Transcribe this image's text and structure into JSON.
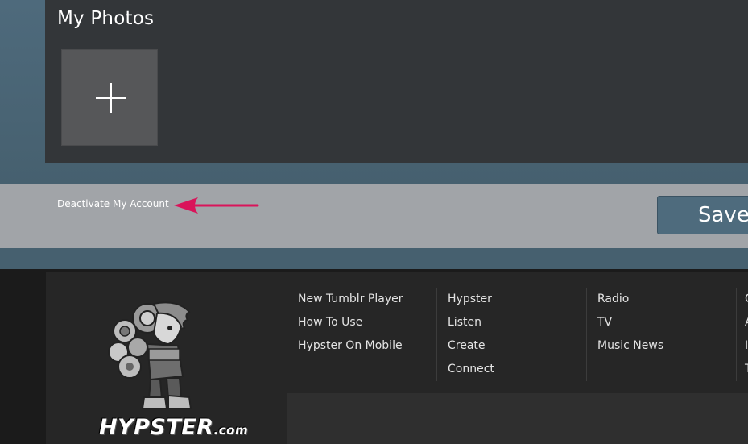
{
  "photos": {
    "title": "My Photos",
    "add_icon": "plus-icon"
  },
  "actions": {
    "deactivate_label": "Deactivate My Account",
    "save_label": "Save",
    "arrow_color": "#d9145a"
  },
  "footer": {
    "logo_text": "HYPSTER",
    "logo_suffix": ".com",
    "columns": [
      {
        "links": [
          "New Tumblr Player",
          "How To Use",
          "Hypster On Mobile"
        ]
      },
      {
        "links": [
          "Hypster",
          "Listen",
          "Create",
          "Connect"
        ]
      },
      {
        "links": [
          "Radio",
          "TV",
          "Music News"
        ]
      },
      {
        "links": [
          "C",
          "A",
          "I",
          "T"
        ]
      }
    ]
  },
  "colors": {
    "panel": "#333639",
    "accent_blue": "#4e6b7d",
    "bar_gray": "#a1a4a8",
    "footer": "#262626"
  }
}
